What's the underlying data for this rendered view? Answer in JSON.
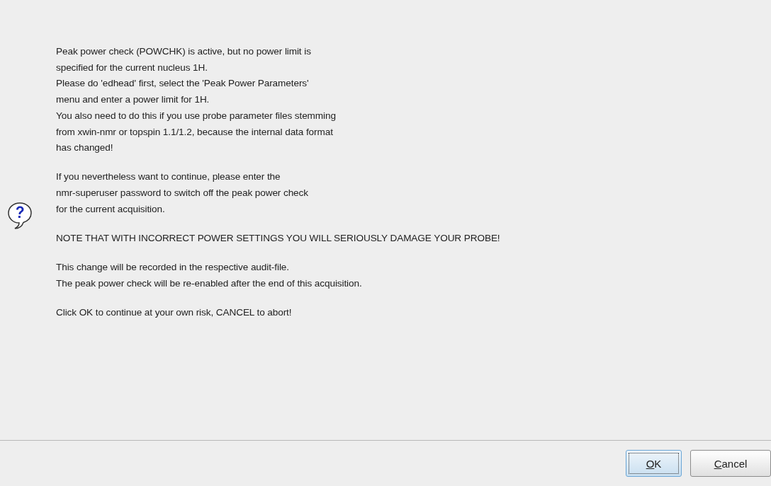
{
  "message": {
    "paragraphs": [
      [
        "Peak power check (POWCHK) is active, but no power limit is",
        "specified for the current nucleus 1H.",
        "Please do 'edhead' first, select the 'Peak Power Parameters'",
        "menu and enter a power limit for 1H.",
        "You also need to do this if you use probe parameter files stemming",
        "from xwin-nmr or topspin 1.1/1.2, because the internal data format",
        "has changed!"
      ],
      [
        "If you nevertheless want to continue, please enter the",
        "nmr-superuser password to switch off the peak power check",
        "for the current acquisition."
      ],
      [
        "NOTE THAT WITH INCORRECT POWER SETTINGS YOU WILL SERIOUSLY DAMAGE YOUR PROBE!"
      ],
      [
        "This change will be recorded in the respective audit-file.",
        "The peak power check will be re-enabled after the end of this acquisition."
      ],
      [
        "Click OK to continue at your own risk, CANCEL to abort!"
      ]
    ]
  },
  "buttons": [
    {
      "mnemonic": "O",
      "rest": "K",
      "focused": true
    },
    {
      "mnemonic": "C",
      "rest": "ancel",
      "focused": false
    }
  ]
}
